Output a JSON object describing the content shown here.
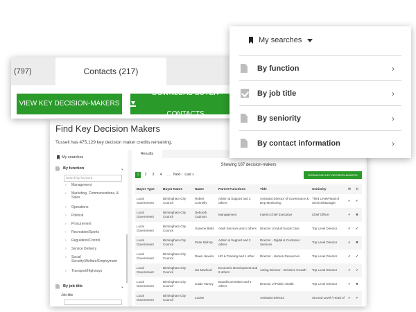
{
  "main": {
    "title": "Find Key Decision Makers",
    "credits": "Tussell has 475,129 key decision maker credits remaining.",
    "my_searches": "My searches",
    "by_function": "By function",
    "keyword_placeholder": "Search by keyword",
    "functions": [
      "Management",
      "Marketing, Communications, & Sales",
      "Operations",
      "Political",
      "Procurement",
      "Recreation/Sports",
      "Regulation/Control",
      "Service Delivery",
      "Social Security/Welfare/Employment",
      "Transport/Highways"
    ],
    "by_job_title": "By job title",
    "job_title_label": "Job title"
  },
  "results": {
    "tab": "Results",
    "showing": "Showing 187 decision-makers",
    "pages": [
      "1",
      "2",
      "3",
      "4",
      "...",
      "Next ›",
      "Last »"
    ],
    "download_small": "DOWNLOAD KEY DECISION-MAKERS",
    "columns": [
      "Buyer Type",
      "Buyer Name",
      "Name",
      "Parent Functions",
      "Title",
      "Seniority",
      "email",
      "phone"
    ],
    "rows": [
      {
        "type": "Local Government",
        "buyer": "Birmingham City Council",
        "name": "Robert Connelly",
        "func": "Admin & Support and 2 others",
        "title": "Assistant Director of Governance & Dep Monitoring",
        "seniority": "Third Level/Head of Service/Manager",
        "email": "✔",
        "phone": "✔"
      },
      {
        "type": "Local Government",
        "buyer": "Birmingham City Council",
        "name": "Deborah Cadman",
        "func": "Management",
        "title": "Interim Chief Executive",
        "seniority": "Chief Officer",
        "email": "✔",
        "phone": "✖"
      },
      {
        "type": "Local Government",
        "buyer": "Birmingham City Council",
        "name": "Graeme Betts",
        "func": "Adult Services and 1 others",
        "title": "Director of Adult Social Care",
        "seniority": "Top Level Director",
        "email": "✔",
        "phone": "✔"
      },
      {
        "type": "Local Government",
        "buyer": "Birmingham City Council",
        "name": "Peter Bishop",
        "func": "Admin & Support and 2 others",
        "title": "Director - Digital & Customer Services",
        "seniority": "Top Level Director",
        "email": "✔",
        "phone": "✖"
      },
      {
        "type": "Local Government",
        "buyer": "Birmingham City Council",
        "name": "Dawn Hewins",
        "func": "HR & Training and 1 other",
        "title": "Director - Human Resources",
        "seniority": "Top Level Director",
        "email": "✔",
        "phone": "✔"
      },
      {
        "type": "Local Government",
        "buyer": "Birmingham City Council",
        "name": "Ian Macleod",
        "func": "Economic Development and 8 others",
        "title": "Acting Director - Inclusive Growth",
        "seniority": "Top Level Director",
        "email": "✔",
        "phone": "✔"
      },
      {
        "type": "Local Government",
        "buyer": "Birmingham City Council",
        "name": "Justin Varney",
        "func": "Board/Committee and 2 others",
        "title": "Director of Public Health",
        "seniority": "Top Level Director",
        "email": "✔",
        "phone": "✖"
      },
      {
        "type": "Local Government",
        "buyer": "Birmingham City Council",
        "name": "Louise",
        "func": "",
        "title": "Assistant Director",
        "seniority": "Second Level / Head of",
        "email": "✔",
        "phone": "✔"
      }
    ]
  },
  "contacts_card": {
    "count_tab": "(797)",
    "contacts_tab": "Contacts (217)",
    "view_button": "VIEW KEY DECISION-MAKERS",
    "download_button": "DOWNLOAD BUYER CONTACTS"
  },
  "searches_card": {
    "header": "My searches",
    "items": [
      "By function",
      "By job title",
      "By seniority",
      "By contact information"
    ]
  },
  "colors": {
    "accent": "#2a9a2a",
    "danger": "#d02828"
  }
}
